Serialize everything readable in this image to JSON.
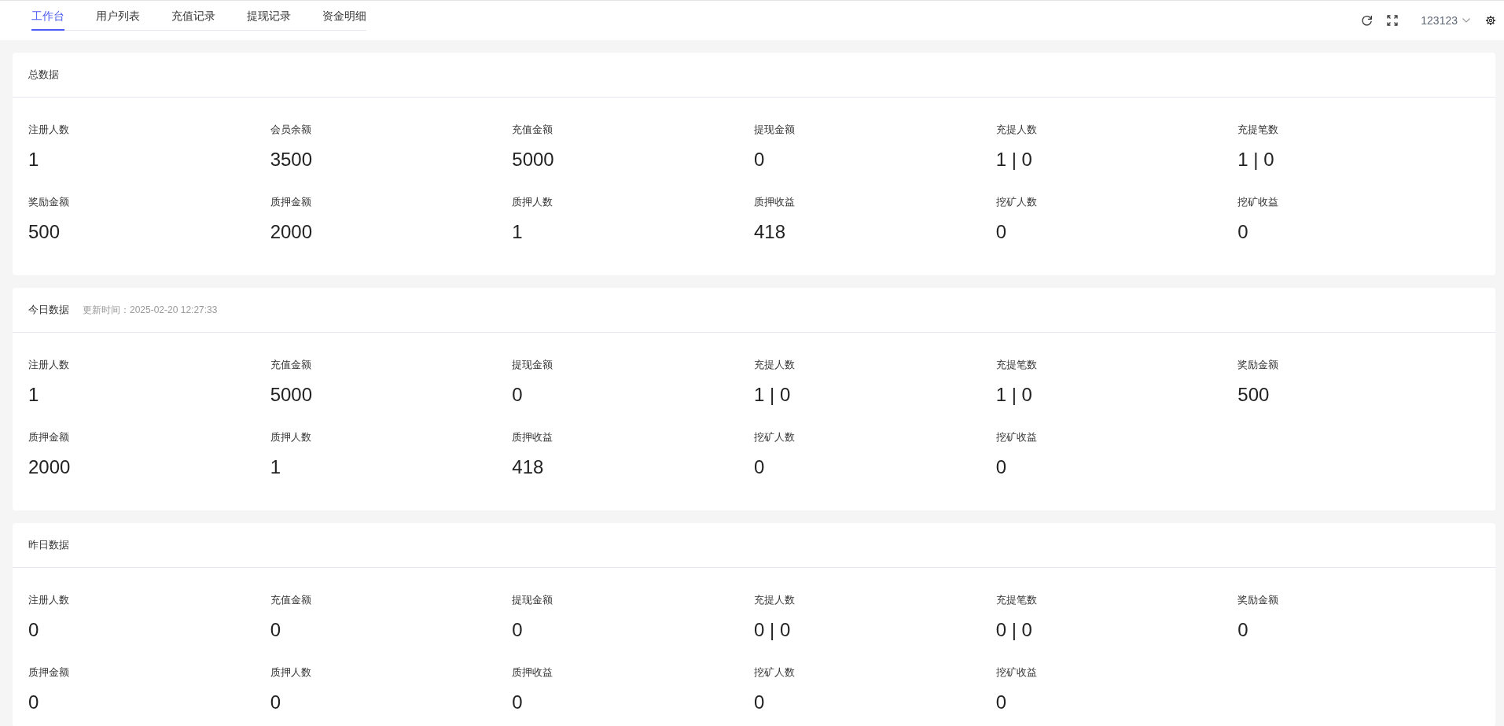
{
  "top_bar": {
    "tabs": [
      {
        "label": "工作台",
        "selected": true
      },
      {
        "label": "用户列表",
        "selected": false
      },
      {
        "label": "充值记录",
        "selected": false
      },
      {
        "label": "提现记录",
        "selected": false
      },
      {
        "label": "资金明细",
        "selected": false
      }
    ],
    "user": {
      "name": "123123"
    }
  },
  "sections": [
    {
      "title": "总数据",
      "stats": [
        {
          "label": "注册人数",
          "value": "1"
        },
        {
          "label": "会员余额",
          "value": "3500"
        },
        {
          "label": "充值金额",
          "value": "5000"
        },
        {
          "label": "提现金额",
          "value": "0"
        },
        {
          "label": "充提人数",
          "value": "1 | 0"
        },
        {
          "label": "充提笔数",
          "value": "1 | 0"
        },
        {
          "label": "奖励金额",
          "value": "500"
        },
        {
          "label": "质押金额",
          "value": "2000"
        },
        {
          "label": "质押人数",
          "value": "1"
        },
        {
          "label": "质押收益",
          "value": "418"
        },
        {
          "label": "挖矿人数",
          "value": "0"
        },
        {
          "label": "挖矿收益",
          "value": "0"
        }
      ]
    },
    {
      "title": "今日数据",
      "updated": "更新时间：2025-02-20 12:27:33",
      "stats": [
        {
          "label": "注册人数",
          "value": "1"
        },
        {
          "label": "充值金额",
          "value": "5000"
        },
        {
          "label": "提现金额",
          "value": "0"
        },
        {
          "label": "充提人数",
          "value": "1 | 0"
        },
        {
          "label": "充提笔数",
          "value": "1 | 0"
        },
        {
          "label": "奖励金额",
          "value": "500"
        },
        {
          "label": "质押金额",
          "value": "2000"
        },
        {
          "label": "质押人数",
          "value": "1"
        },
        {
          "label": "质押收益",
          "value": "418"
        },
        {
          "label": "挖矿人数",
          "value": "0"
        },
        {
          "label": "挖矿收益",
          "value": "0"
        }
      ]
    },
    {
      "title": "昨日数据",
      "stats": [
        {
          "label": "注册人数",
          "value": "0"
        },
        {
          "label": "充值金额",
          "value": "0"
        },
        {
          "label": "提现金额",
          "value": "0"
        },
        {
          "label": "充提人数",
          "value": "0 | 0"
        },
        {
          "label": "充提笔数",
          "value": "0 | 0"
        },
        {
          "label": "奖励金额",
          "value": "0"
        },
        {
          "label": "质押金额",
          "value": "0"
        },
        {
          "label": "质押人数",
          "value": "0"
        },
        {
          "label": "质押收益",
          "value": "0"
        },
        {
          "label": "挖矿人数",
          "value": "0"
        },
        {
          "label": "挖矿收益",
          "value": "0"
        }
      ]
    }
  ]
}
